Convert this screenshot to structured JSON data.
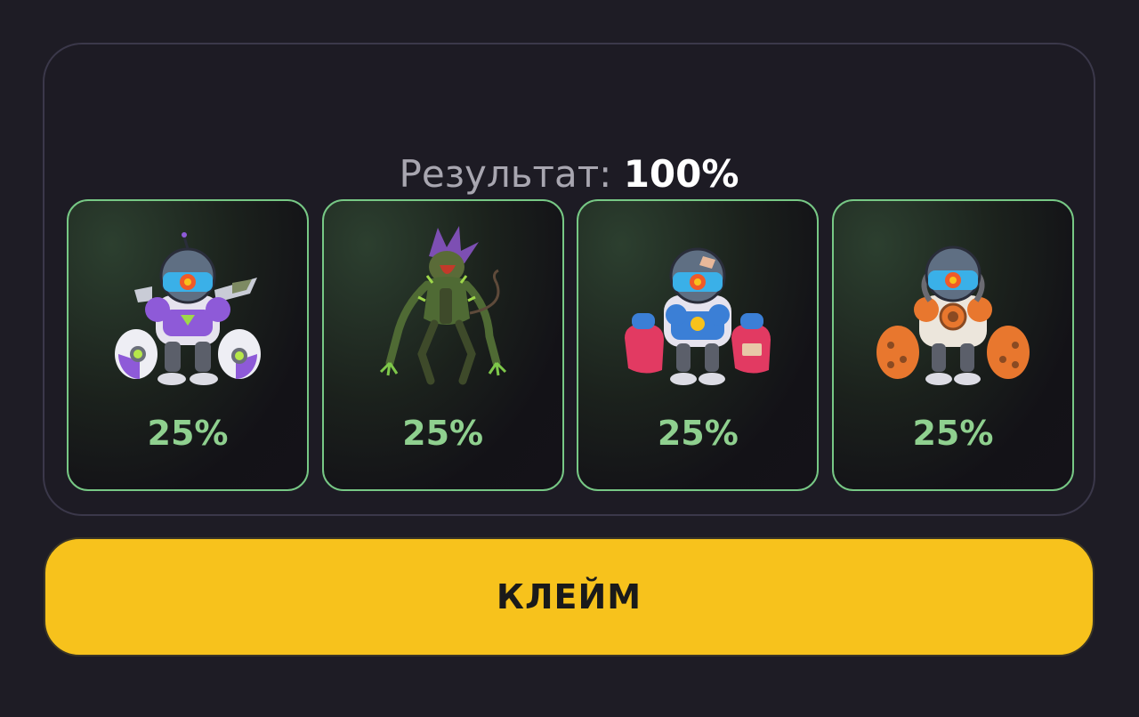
{
  "result": {
    "label": "Результат:",
    "value": "100%"
  },
  "cards": [
    {
      "name": "purple-robot-icon",
      "percent": "25%",
      "accent": "#8e5ad8"
    },
    {
      "name": "green-mutant-icon",
      "percent": "25%",
      "accent": "#4f6a34"
    },
    {
      "name": "blue-red-robot-icon",
      "percent": "25%",
      "accent": "#3b7fd6"
    },
    {
      "name": "orange-robot-icon",
      "percent": "25%",
      "accent": "#e8772e"
    }
  ],
  "claim_button": {
    "label": "КЛЕЙМ"
  },
  "colors": {
    "background": "#1e1c25",
    "card_border": "#77c885",
    "percent_text": "#8fd08f",
    "button": "#f7c21c"
  }
}
